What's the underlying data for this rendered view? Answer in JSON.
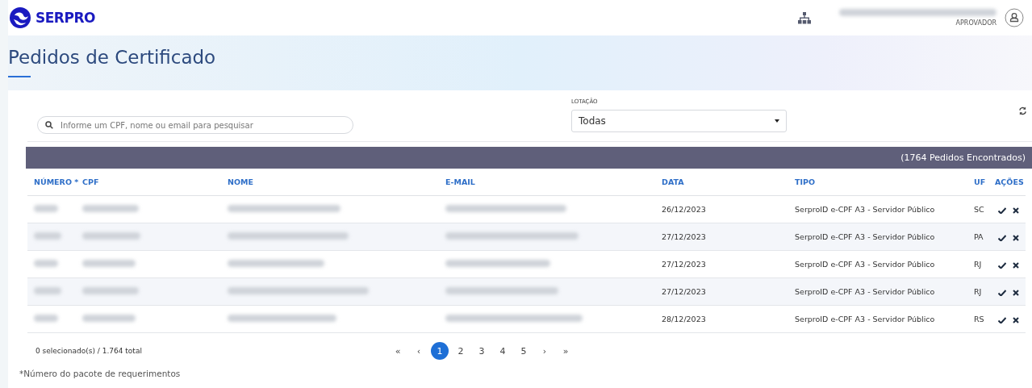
{
  "header": {
    "logo": "SERPRO",
    "role": "APROVADOR"
  },
  "title": "Pedidos de Certificado",
  "filters": {
    "search": {
      "placeholder": "Informe um CPF, nome ou email para pesquisar"
    },
    "lotacao": {
      "label": "LOTAÇÃO",
      "value": "Todas"
    }
  },
  "table": {
    "found": "(1764 Pedidos Encontrados)",
    "columns": [
      "NÚMERO *",
      "CPF",
      "NOME",
      "E-MAIL",
      "DATA",
      "TIPO",
      "UF",
      "AÇÕES"
    ],
    "rows": [
      {
        "data": "26/12/2023",
        "tipo": "SerproID e-CPF A3 - Servidor Público",
        "uf": "SC"
      },
      {
        "data": "27/12/2023",
        "tipo": "SerproID e-CPF A3 - Servidor Público",
        "uf": "PA"
      },
      {
        "data": "27/12/2023",
        "tipo": "SerproID e-CPF A3 - Servidor Público",
        "uf": "RJ"
      },
      {
        "data": "27/12/2023",
        "tipo": "SerproID e-CPF A3 - Servidor Público",
        "uf": "RJ"
      },
      {
        "data": "28/12/2023",
        "tipo": "SerproID e-CPF A3 - Servidor Público",
        "uf": "RS"
      }
    ]
  },
  "footer": {
    "selection": "0 selecionado(s) / 1.764 total",
    "pages": [
      {
        "label": "«",
        "selected": false
      },
      {
        "label": "‹",
        "selected": false
      },
      {
        "label": "1",
        "selected": true
      },
      {
        "label": "2",
        "selected": false
      },
      {
        "label": "3",
        "selected": false
      },
      {
        "label": "4",
        "selected": false
      },
      {
        "label": "5",
        "selected": false
      },
      {
        "label": "›",
        "selected": false
      },
      {
        "label": "»",
        "selected": false
      }
    ]
  },
  "note": "*Número do pacote de requerimentos"
}
